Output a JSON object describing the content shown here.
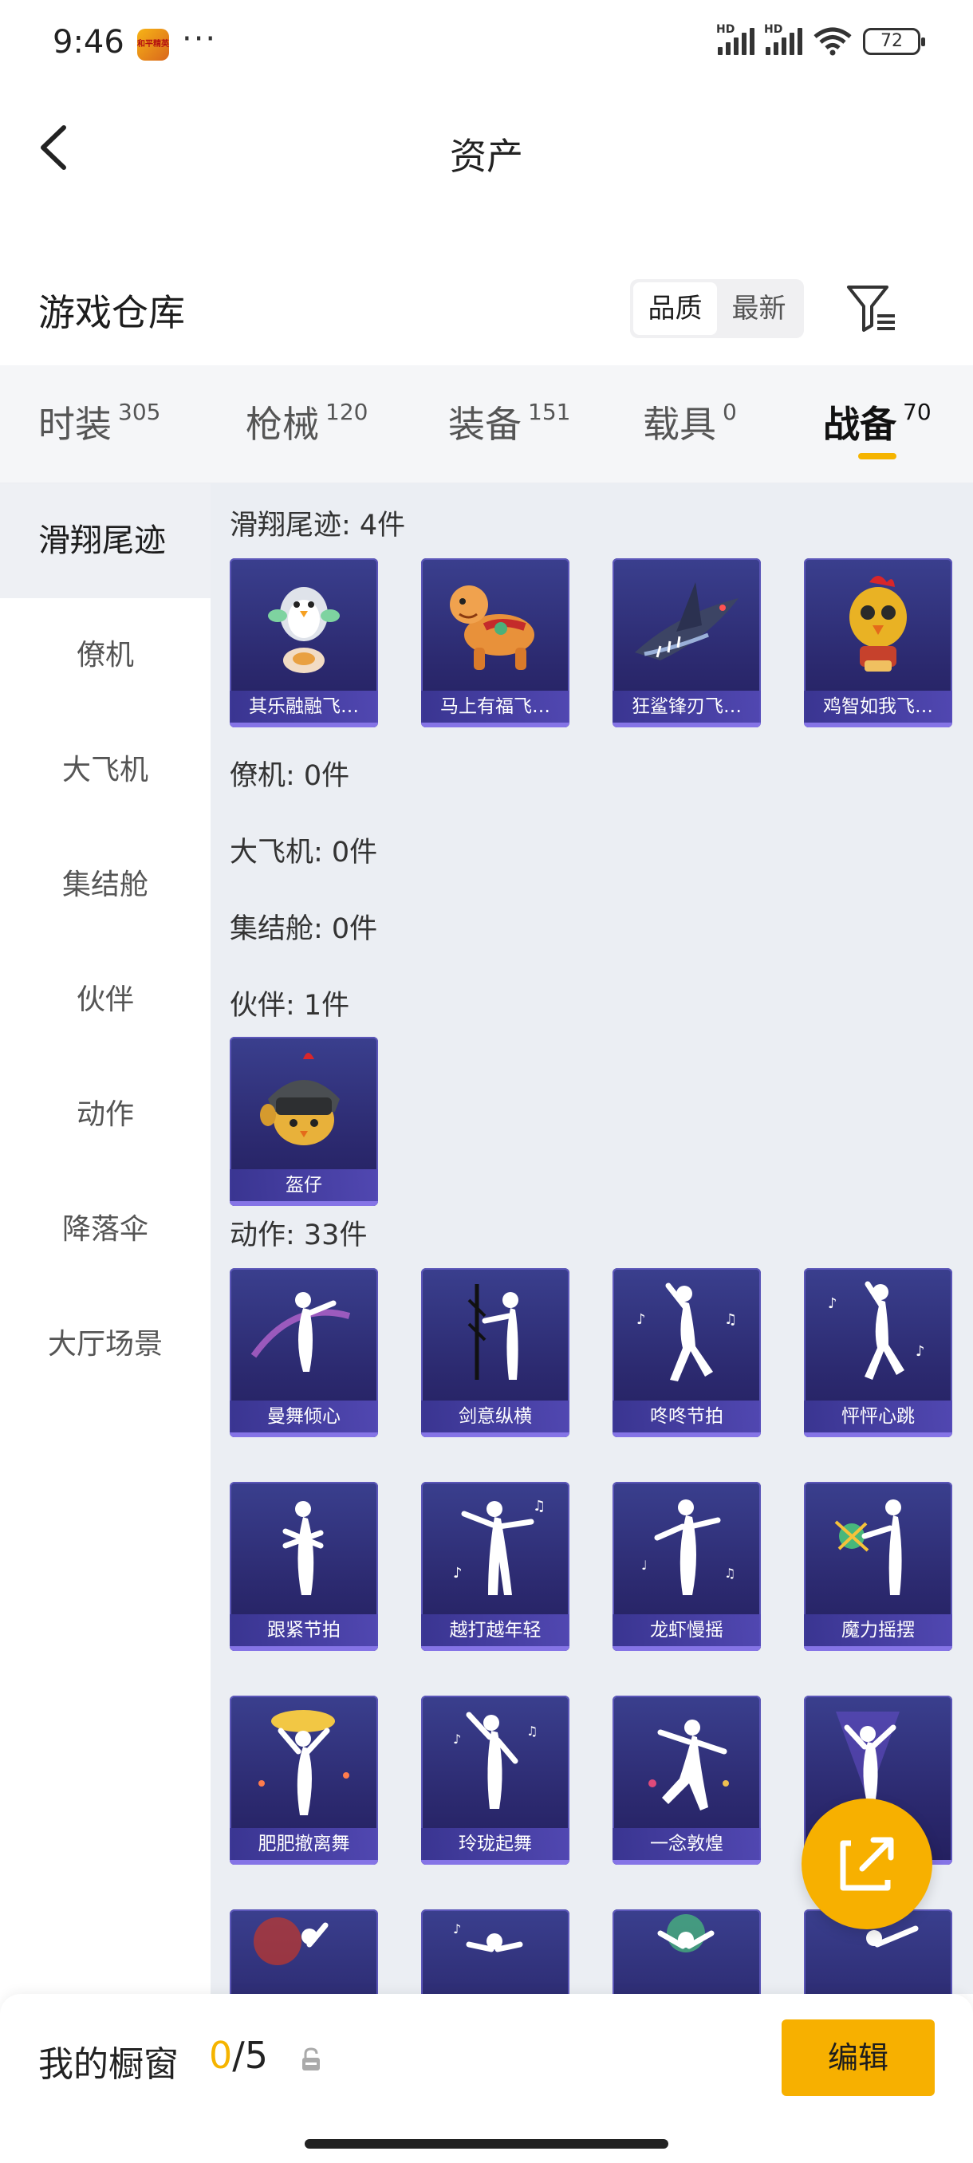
{
  "status": {
    "time": "9:46",
    "app_badge": "和平精英",
    "dots": "···",
    "hd": "HD",
    "battery": "72"
  },
  "nav": {
    "title": "资产"
  },
  "warehouse": {
    "title": "游戏仓库",
    "sort_quality": "品质",
    "sort_latest": "最新"
  },
  "tabs": [
    {
      "label": "时装",
      "count": "305"
    },
    {
      "label": "枪械",
      "count": "120"
    },
    {
      "label": "装备",
      "count": "151"
    },
    {
      "label": "载具",
      "count": "0"
    },
    {
      "label": "战备",
      "count": "70"
    }
  ],
  "sidebar": [
    "滑翔尾迹",
    "僚机",
    "大飞机",
    "集结舱",
    "伙伴",
    "动作",
    "降落伞",
    "大厅场景"
  ],
  "sections": {
    "glide": {
      "title": "滑翔尾迹: 4件",
      "items": [
        "其乐融融飞…",
        "马上有福飞…",
        "狂鲨锋刃飞…",
        "鸡智如我飞…"
      ]
    },
    "wingman": {
      "title": "僚机: 0件"
    },
    "plane": {
      "title": "大飞机: 0件"
    },
    "pod": {
      "title": "集结舱: 0件"
    },
    "partner": {
      "title": "伙伴: 1件",
      "items": [
        "盔仔"
      ]
    },
    "emote": {
      "title": "动作: 33件",
      "items": [
        "曼舞倾心",
        "剑意纵横",
        "咚咚节拍",
        "怦怦心跳",
        "跟紧节拍",
        "越打越年轻",
        "龙虾慢摇",
        "魔力摇摆",
        "肥肥撤离舞",
        "玲珑起舞",
        "一念敦煌"
      ]
    }
  },
  "bottom": {
    "showcase_label": "我的橱窗",
    "showcase_current": "0",
    "showcase_total": "/5",
    "edit_label": "编辑"
  },
  "colors": {
    "accent": "#f5b400",
    "card_bg": "#2c2a70"
  }
}
